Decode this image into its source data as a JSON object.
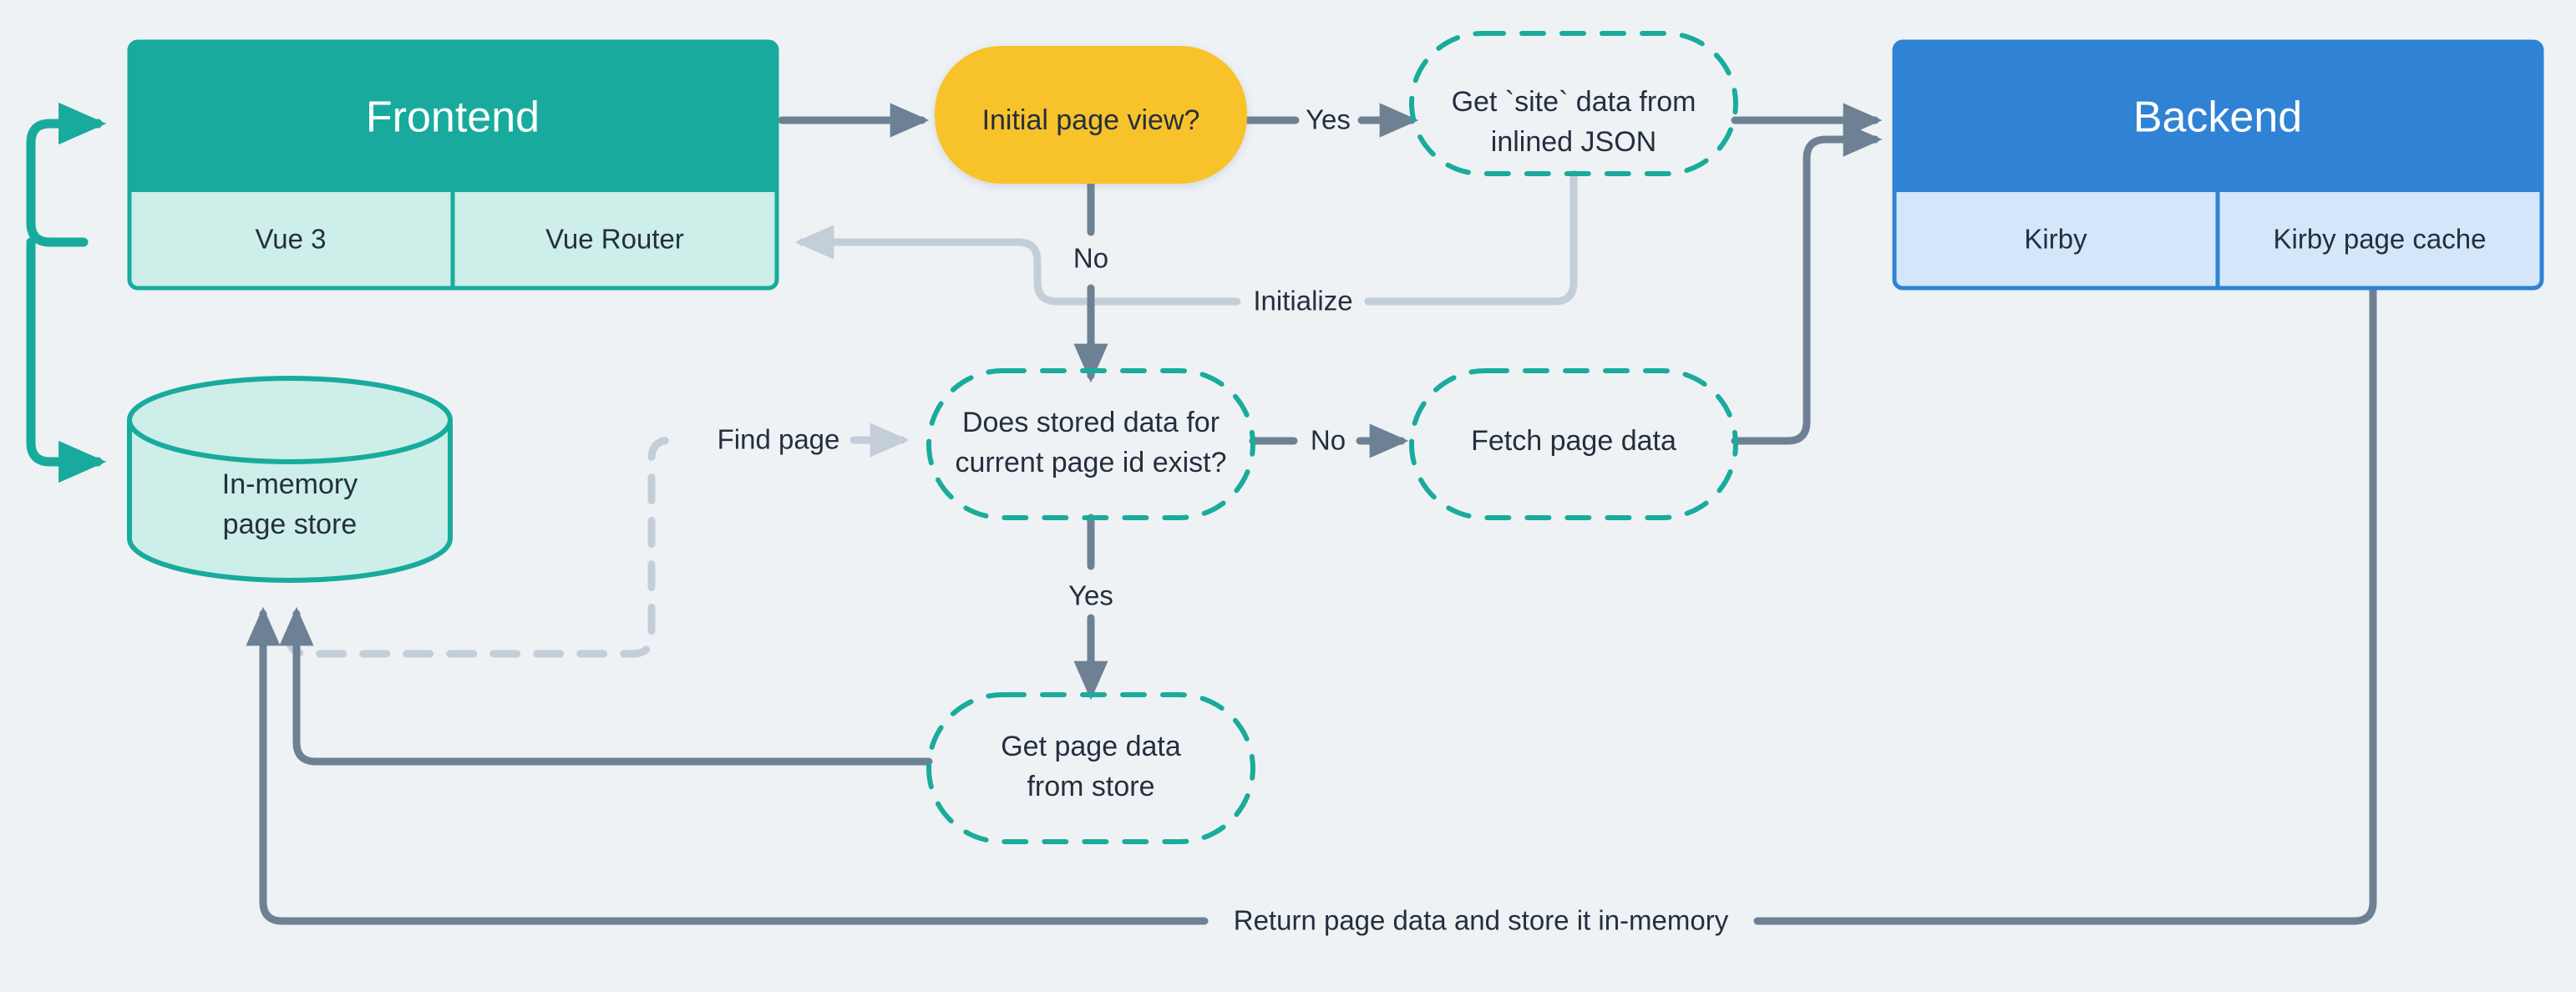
{
  "diagram": {
    "title_frontend": "Frontend",
    "title_backend": "Backend",
    "background_color": "#eef2f5",
    "colors": {
      "frontend_fill": "#18ab9d",
      "frontend_sub_fill": "#cdeee9",
      "backend_fill": "#2f82d4",
      "backend_sub_fill": "#d3e6fa",
      "decision_fill": "#f8c22c",
      "dashed_stroke": "#1aab9b",
      "edge_solid": "#6e8194",
      "edge_muted": "#c3ced8",
      "text": "#242f3e"
    }
  },
  "nodes": {
    "frontend": {
      "label": "Frontend",
      "shape": "rect"
    },
    "frontend_sub": [
      {
        "label": "Vue 3"
      },
      {
        "label": "Vue Router"
      }
    ],
    "backend": {
      "label": "Backend",
      "shape": "rect"
    },
    "backend_sub": [
      {
        "label": "Kirby"
      },
      {
        "label": "Kirby page cache"
      }
    ],
    "store": {
      "label_line1": "In-memory",
      "label_line2": "page store",
      "shape": "cylinder"
    },
    "initial_page_view": {
      "label": "Initial page view?",
      "shape": "decision"
    },
    "get_site_data": {
      "label_line1": "Get `site` data from",
      "label_line2": "inlined JSON",
      "shape": "dashed-stadium"
    },
    "stored_data_exists": {
      "label_line1": "Does stored data for",
      "label_line2": "current page id exist?",
      "shape": "dashed-stadium"
    },
    "fetch_page_data": {
      "label": "Fetch page data",
      "shape": "dashed-stadium"
    },
    "get_page_from_store": {
      "label_line1": "Get page data",
      "label_line2": "from store",
      "shape": "dashed-stadium"
    }
  },
  "edges": [
    {
      "id": "frontend-to-initial",
      "label": ""
    },
    {
      "id": "initial-yes",
      "label": "Yes"
    },
    {
      "id": "initial-no",
      "label": "No"
    },
    {
      "id": "site-to-backend",
      "label": ""
    },
    {
      "id": "site-initialize-router",
      "label": "Initialize"
    },
    {
      "id": "store-find-page",
      "label": "Find page"
    },
    {
      "id": "stored-no",
      "label": "No"
    },
    {
      "id": "stored-yes",
      "label": "Yes"
    },
    {
      "id": "fetch-to-backend",
      "label": ""
    },
    {
      "id": "store-get-page",
      "label": ""
    },
    {
      "id": "return-page-data",
      "label": "Return page data and store it in-memory"
    }
  ]
}
